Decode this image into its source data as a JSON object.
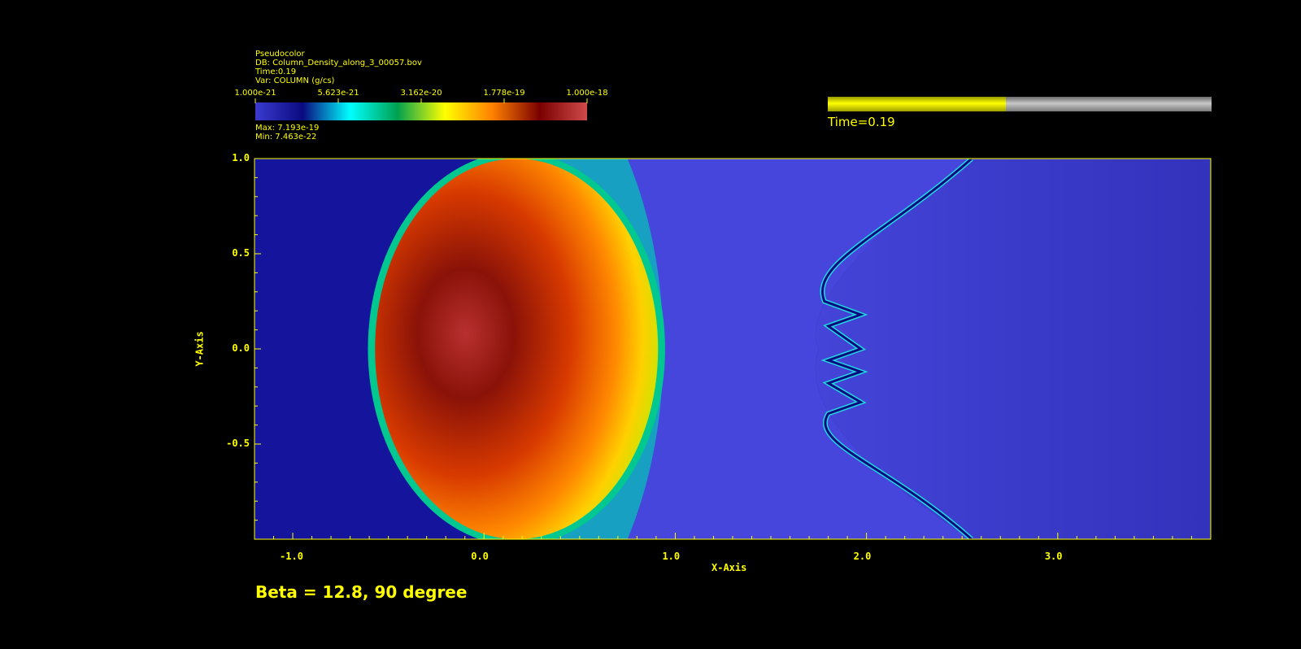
{
  "legend": {
    "plot_type": "Pseudocolor",
    "db_line": "DB: Column_Density_along_3_00057.bov",
    "time_line": "Time:0.19",
    "var_line": "Var: COLUMN (g/cs)",
    "max_line": "Max:  7.193e-19",
    "min_line": "Min:  7.463e-22",
    "tick_labels": [
      "1.000e-21",
      "5.623e-21",
      "3.162e-20",
      "1.778e-19",
      "1.000e-18"
    ],
    "colormap": [
      "#3a3ad0",
      "#0a0a80",
      "#00ffff",
      "#00a050",
      "#ffff00",
      "#ff8000",
      "#7a0000",
      "#d04a4a"
    ]
  },
  "time_slider": {
    "label": "Time=0.19",
    "progress": 0.465,
    "fill_color": "#ffff00",
    "track_color": "#9a9a9a"
  },
  "caption": "Beta = 12.8, 90 degree",
  "chart_data": {
    "type": "heatmap",
    "title": "",
    "xlabel": "X-Axis",
    "ylabel": "Y-Axis",
    "xlim": [
      -1.2,
      3.8
    ],
    "ylim": [
      -1.0,
      1.0
    ],
    "x_ticks": [
      {
        "value": -1.0,
        "label": "-1.0"
      },
      {
        "value": 0.0,
        "label": "0.0"
      },
      {
        "value": 1.0,
        "label": "1.0"
      },
      {
        "value": 2.0,
        "label": "2.0"
      },
      {
        "value": 3.0,
        "label": "3.0"
      }
    ],
    "y_ticks": [
      {
        "value": 1.0,
        "label": "1.0"
      },
      {
        "value": 0.5,
        "label": "0.5"
      },
      {
        "value": 0.0,
        "label": "0.0"
      },
      {
        "value": -0.5,
        "label": "-0.5"
      }
    ],
    "color_scale": "log",
    "value_range": [
      1e-21,
      1e-18
    ],
    "data_max": 7.193e-19,
    "data_min": 7.463e-22,
    "background_color": "#1010a0",
    "grid": false
  }
}
